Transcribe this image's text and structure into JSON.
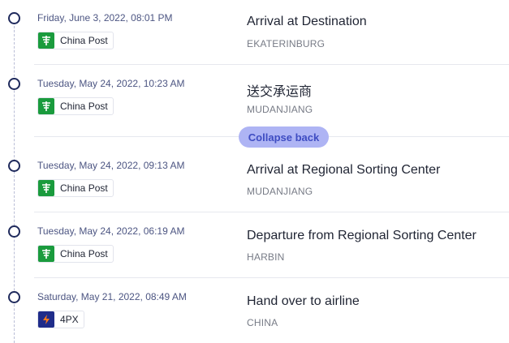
{
  "events": [
    {
      "date": "Friday, June 3, 2022, 08:01 PM",
      "carrier": "China Post",
      "carrier_icon": "china-post-logo",
      "status": "Arrival at Destination",
      "location": "EKATERINBURG"
    },
    {
      "date": "Tuesday, May 24, 2022, 10:23 AM",
      "carrier": "China Post",
      "carrier_icon": "china-post-logo",
      "status": "送交承运商",
      "location": "MUDANJIANG"
    },
    {
      "date": "Tuesday, May 24, 2022, 09:13 AM",
      "carrier": "China Post",
      "carrier_icon": "china-post-logo",
      "status": "Arrival at Regional Sorting Center",
      "location": "MUDANJIANG"
    },
    {
      "date": "Tuesday, May 24, 2022, 06:19 AM",
      "carrier": "China Post",
      "carrier_icon": "china-post-logo",
      "status": "Departure from Regional Sorting Center",
      "location": "HARBIN"
    },
    {
      "date": "Saturday, May 21, 2022, 08:49 AM",
      "carrier": "4PX",
      "carrier_icon": "4px-logo",
      "status": "Hand over to airline",
      "location": "CHINA"
    }
  ],
  "collapse_label": "Collapse back",
  "colors": {
    "accent_pill_bg": "#aeb4f4",
    "accent_pill_text": "#3e4cc2",
    "china_post_green": "#1a9b3d",
    "fpx_blue": "#1f2c8a",
    "timeline_dot": "#1f2a5c"
  }
}
